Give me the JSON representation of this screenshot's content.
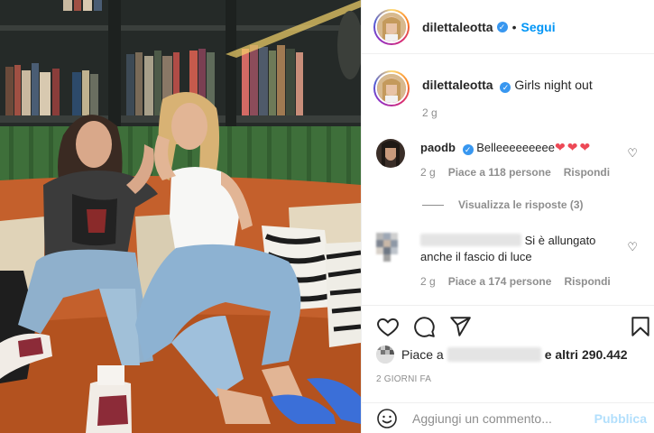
{
  "post": {
    "username": "dilettaleotta",
    "follow_label": "Segui",
    "separator": "•",
    "caption": "Girls night out",
    "caption_time": "2 g"
  },
  "comments": [
    {
      "username": "paodb",
      "text": "Belleeeeeeeee",
      "emoji": "❤❤❤",
      "time": "2 g",
      "likes": "Piace a 118 persone",
      "reply": "Rispondi"
    },
    {
      "username": "",
      "text": "Si è allungato anche il fascio di luce",
      "time": "2 g",
      "likes": "Piace a 174 persone",
      "reply": "Rispondi"
    }
  ],
  "view_replies": "Visualizza le risposte (3)",
  "likes": {
    "prefix": "Piace a",
    "suffix": "e altri 290.442"
  },
  "date": "2 GIORNI FA",
  "add_comment": {
    "placeholder": "Aggiungi un commento...",
    "publish": "Pubblica"
  },
  "colors": {
    "link_blue": "#0095f6",
    "verified_blue": "#3897f0",
    "heart_red": "#ed4956",
    "muted": "#8e8e8e"
  },
  "icons": [
    "verified-badge-icon",
    "heart-icon",
    "comment-icon",
    "share-icon",
    "bookmark-icon",
    "emoji-icon"
  ]
}
